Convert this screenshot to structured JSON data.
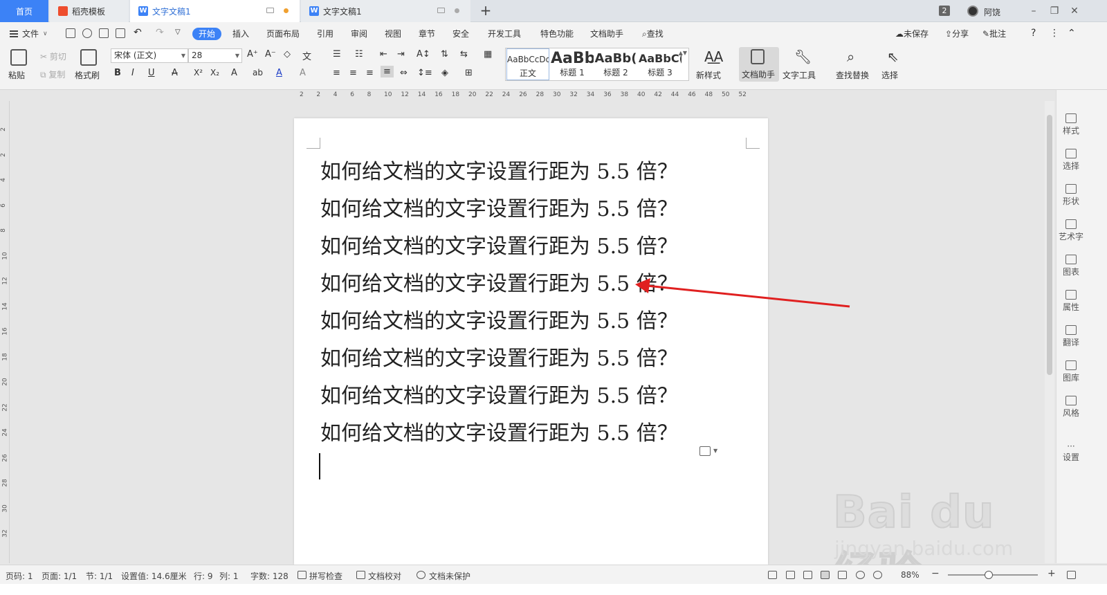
{
  "tabs": {
    "home": "首页",
    "template": "稻壳模板",
    "doc1": "文字文稿1",
    "doc2": "文字文稿1",
    "new_tab": "+"
  },
  "titlebar": {
    "badge": "2",
    "username": "阿饶",
    "minimize": "–",
    "restore": "❐",
    "close": "✕"
  },
  "menubar": {
    "file": "文件",
    "tabs": [
      "开始",
      "插入",
      "页面布局",
      "引用",
      "审阅",
      "视图",
      "章节",
      "安全",
      "开发工具",
      "特色功能",
      "文档助手",
      "查找"
    ],
    "active_tab": "开始",
    "right": [
      "未保存",
      "分享",
      "批注",
      "?",
      "⋮",
      "⌃"
    ]
  },
  "ribbon": {
    "paste": "粘贴",
    "cut": "剪切",
    "copy": "复制",
    "format_painter": "格式刷",
    "font_name": "宋体 (正文)",
    "font_size": "28",
    "format_buttons": [
      "B",
      "I",
      "U",
      "A",
      "X²",
      "X₂",
      "A",
      "ab",
      "A",
      "A"
    ],
    "styles": [
      {
        "preview": "AaBbCcDd",
        "label": "正文"
      },
      {
        "preview": "AaBb",
        "label": "标题 1"
      },
      {
        "preview": "AaBb(",
        "label": "标题 2"
      },
      {
        "preview": "AaBbC(",
        "label": "标题 3"
      }
    ],
    "new_style": "新样式",
    "doc_assistant": "文档助手",
    "text_tools": "文字工具",
    "find_replace": "查找替换",
    "select": "选择"
  },
  "ruler": {
    "ticks": [
      "2",
      "2",
      "4",
      "6",
      "8",
      "10",
      "12",
      "14",
      "16",
      "18",
      "20",
      "22",
      "24",
      "26",
      "28",
      "30",
      "32",
      "34",
      "36",
      "38",
      "40",
      "42",
      "44",
      "46",
      "48",
      "50",
      "52"
    ],
    "vticks": [
      "2",
      "2",
      "4",
      "6",
      "8",
      "10",
      "12",
      "14",
      "16",
      "18",
      "20",
      "22",
      "24",
      "26",
      "28",
      "30",
      "32"
    ]
  },
  "document": {
    "lines": [
      "如何给文档的文字设置行距为 5.5 倍？",
      "如何给文档的文字设置行距为 5.5 倍？",
      "如何给文档的文字设置行距为 5.5 倍？",
      "如何给文档的文字设置行距为 5.5 倍？",
      "如何给文档的文字设置行距为 5.5 倍？",
      "如何给文档的文字设置行距为 5.5 倍？",
      "如何给文档的文字设置行距为 5.5 倍？",
      "如何给文档的文字设置行距为 5.5 倍？"
    ]
  },
  "sidebar": {
    "items": [
      "样式",
      "选择",
      "形状",
      "艺术字",
      "图表",
      "属性",
      "翻译",
      "图库",
      "风格",
      "设置"
    ]
  },
  "statusbar": {
    "page_num": "页码: 1",
    "page": "页面: 1/1",
    "section": "节: 1/1",
    "setting": "设置值: 14.6厘米",
    "row": "行: 9",
    "col": "列: 1",
    "word_count": "字数: 128",
    "spell_check": "拼写检查",
    "doc_proof": "文档校对",
    "doc_unprotected": "文档未保护",
    "zoom": "88%",
    "zoom_level": 0.45
  },
  "watermark": {
    "main": "Bai du 经验",
    "sub": "jingyan.baidu.com"
  },
  "colors": {
    "accent": "#3c82f6",
    "arrow": "#e02020"
  }
}
